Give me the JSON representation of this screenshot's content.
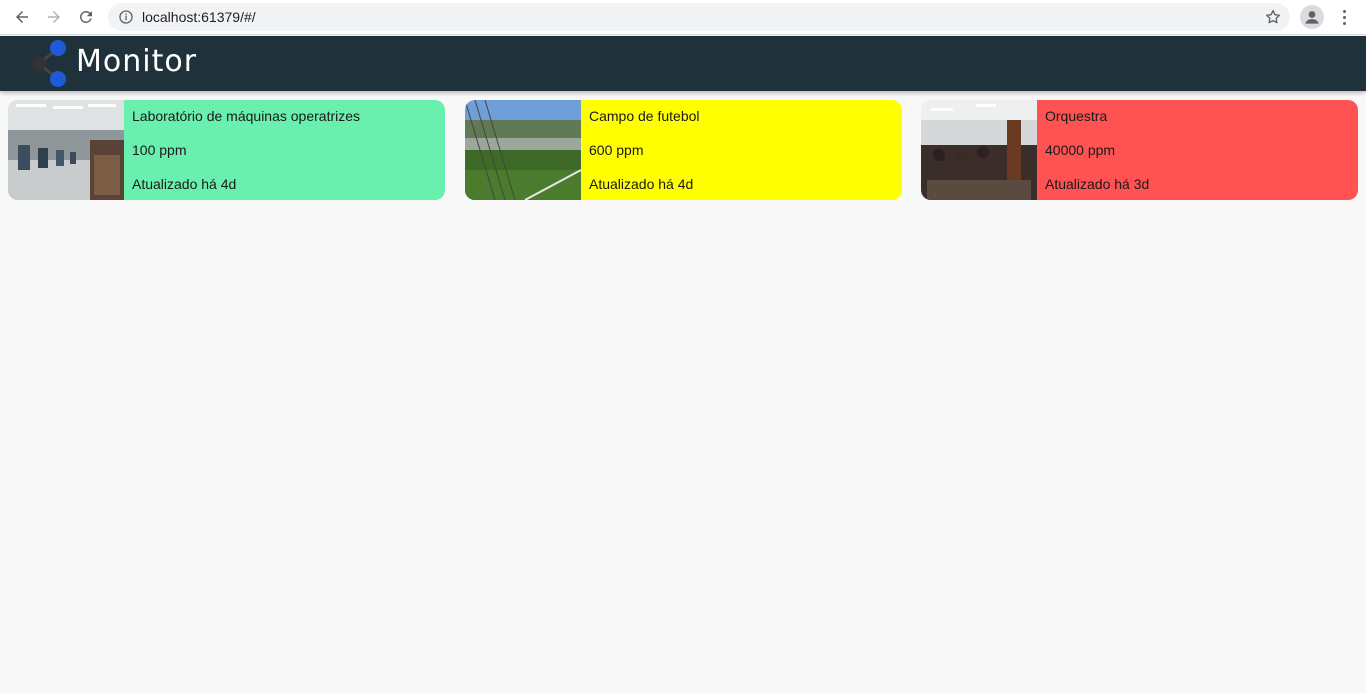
{
  "browser": {
    "url": "localhost:61379/#/"
  },
  "app": {
    "title": "Monitor"
  },
  "cards": [
    {
      "name": "Laboratório de máquinas operatrizes",
      "value": "100 ppm",
      "updated": "Atualizado há 4d",
      "color": "#69f0ae",
      "image": "machine-lab-photo"
    },
    {
      "name": "Campo de futebol",
      "value": "600 ppm",
      "updated": "Atualizado há 4d",
      "color": "#ffff00",
      "image": "football-field-photo"
    },
    {
      "name": "Orquestra",
      "value": "40000 ppm",
      "updated": "Atualizado há 3d",
      "color": "#ff5252",
      "image": "orchestra-photo"
    }
  ]
}
